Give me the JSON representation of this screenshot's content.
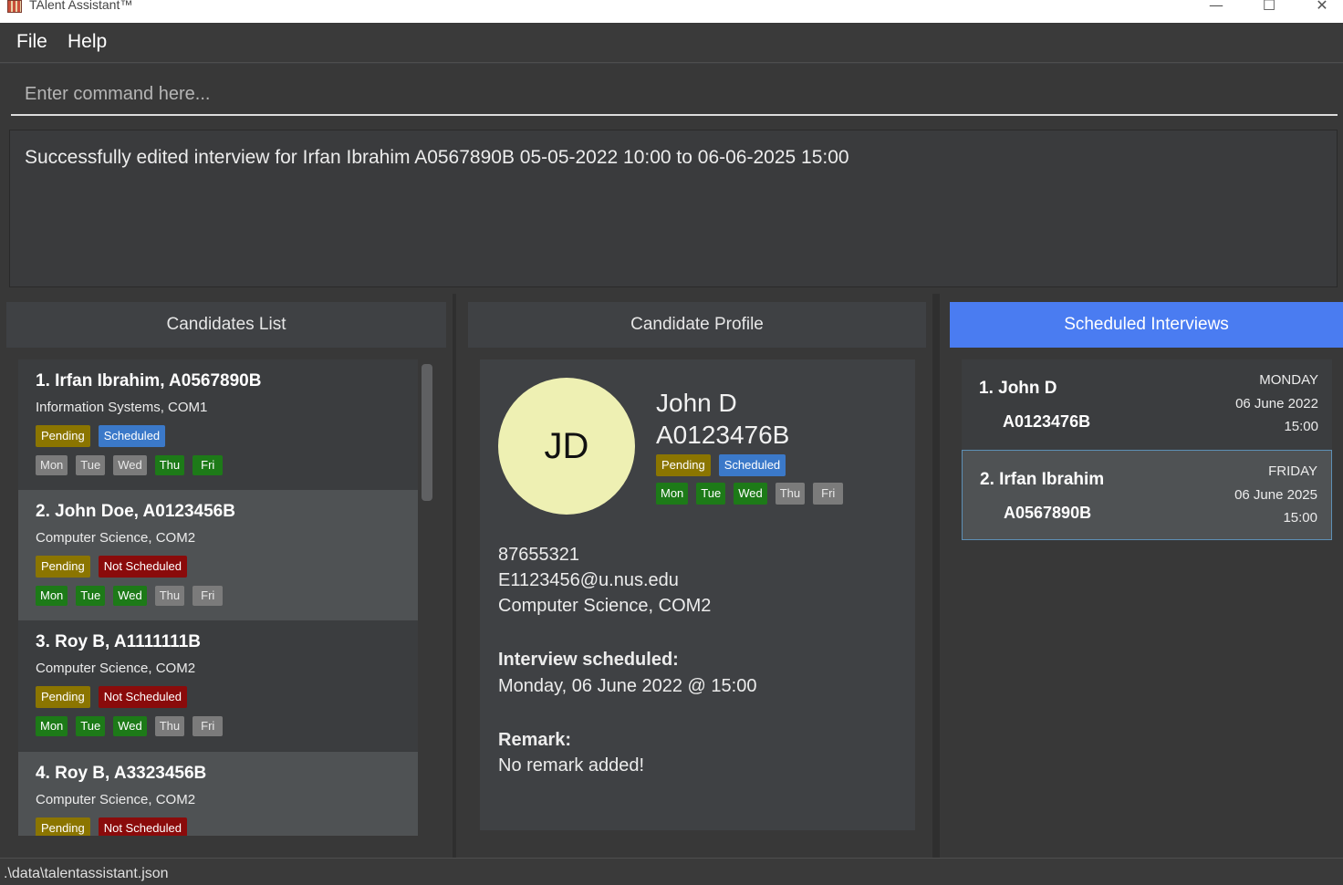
{
  "window": {
    "title": "TAlent Assistant™",
    "controls": {
      "minimize": "—",
      "maximize": "☐",
      "close": "✕"
    }
  },
  "menu": {
    "file": "File",
    "help": "Help"
  },
  "command": {
    "placeholder": "Enter command here...",
    "value": ""
  },
  "result": {
    "message": "Successfully edited interview for Irfan Ibrahim A0567890B 05-05-2022 10:00 to 06-06-2025 15:00"
  },
  "panels": {
    "candidates_title": "Candidates List",
    "profile_title": "Candidate Profile",
    "interviews_title": "Scheduled Interviews"
  },
  "candidates": [
    {
      "title": "1.  Irfan Ibrahim, A0567890B",
      "subtitle": "Information Systems, COM1",
      "status": "Pending",
      "interview": "Scheduled",
      "days": [
        {
          "label": "Mon",
          "on": false
        },
        {
          "label": "Tue",
          "on": false
        },
        {
          "label": "Wed",
          "on": false
        },
        {
          "label": "Thu",
          "on": true
        },
        {
          "label": "Fri",
          "on": true
        }
      ]
    },
    {
      "title": "2.  John Doe, A0123456B",
      "subtitle": "Computer Science, COM2",
      "status": "Pending",
      "interview": "Not Scheduled",
      "days": [
        {
          "label": "Mon",
          "on": true
        },
        {
          "label": "Tue",
          "on": true
        },
        {
          "label": "Wed",
          "on": true
        },
        {
          "label": "Thu",
          "on": false
        },
        {
          "label": "Fri",
          "on": false
        }
      ]
    },
    {
      "title": "3.  Roy B, A1111111B",
      "subtitle": "Computer Science, COM2",
      "status": "Pending",
      "interview": "Not Scheduled",
      "days": [
        {
          "label": "Mon",
          "on": true
        },
        {
          "label": "Tue",
          "on": true
        },
        {
          "label": "Wed",
          "on": true
        },
        {
          "label": "Thu",
          "on": false
        },
        {
          "label": "Fri",
          "on": false
        }
      ]
    },
    {
      "title": "4.  Roy B, A3323456B",
      "subtitle": "Computer Science, COM2",
      "status": "Pending",
      "interview": "Not Scheduled",
      "days": []
    }
  ],
  "profile": {
    "initials": "JD",
    "name": "John D",
    "student_id": "A0123476B",
    "status": "Pending",
    "interview": "Scheduled",
    "days": [
      {
        "label": "Mon",
        "on": true
      },
      {
        "label": "Tue",
        "on": true
      },
      {
        "label": "Wed",
        "on": true
      },
      {
        "label": "Thu",
        "on": false
      },
      {
        "label": "Fri",
        "on": false
      }
    ],
    "phone": "87655321",
    "email": "E1123456@u.nus.edu",
    "course": "Computer Science, COM2",
    "interview_label": "Interview scheduled:",
    "interview_value": "Monday, 06 June 2022 @ 15:00",
    "remark_label": "Remark:",
    "remark_value": "No remark added!"
  },
  "interviews": [
    {
      "index_name": "1.  John D",
      "id": "A0123476B",
      "day": "MONDAY",
      "date": "06 June 2022",
      "time": "15:00"
    },
    {
      "index_name": "2.  Irfan Ibrahim",
      "id": "A0567890B",
      "day": "FRIDAY",
      "date": "06 June 2025",
      "time": "15:00"
    }
  ],
  "status_bar": {
    "path": ".\\data\\talentassistant.json"
  },
  "colors": {
    "background": "#3c3e40",
    "accent": "#4a7cf1",
    "pending": "#8b7500",
    "scheduled": "#3b79c9",
    "not_scheduled": "#8a0b0b",
    "day_on": "#1d7a18",
    "day_off": "#7b7b7b",
    "avatar": "#eef0b3"
  }
}
